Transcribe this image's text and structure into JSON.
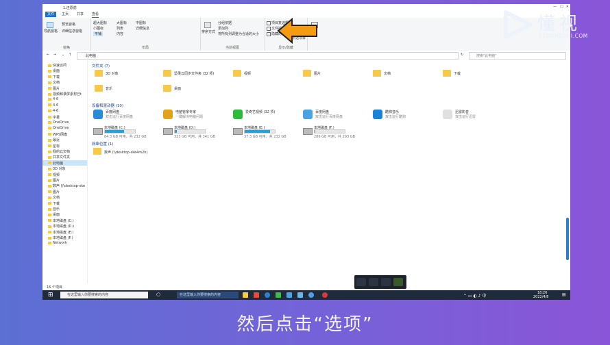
{
  "window": {
    "title": "1.还原前"
  },
  "menubar": {
    "items": [
      "文件",
      "主页",
      "共享",
      "查看"
    ]
  },
  "ribbon": {
    "groups": [
      {
        "name": "窗格",
        "buttons": [
          "导航窗格",
          "预览窗格",
          "详细信息窗格"
        ]
      },
      {
        "name": "布局",
        "buttons": [
          "超大图标",
          "大图标",
          "中图标",
          "小图标",
          "列表",
          "详细信息",
          "平铺",
          "内容"
        ]
      },
      {
        "name": "当前视图",
        "buttons": [
          "排序方式",
          "分组依据",
          "添加列",
          "将所有列调整为合适的大小"
        ]
      },
      {
        "name": "显示/隐藏",
        "buttons": [
          "项目复选框",
          "文件扩展名",
          "隐藏的项目",
          "隐藏",
          "所选项目"
        ]
      },
      {
        "name": "",
        "buttons": [
          "选项"
        ]
      }
    ]
  },
  "addressbar": {
    "path": "此电脑",
    "search_placeholder": "搜索\"此电脑\""
  },
  "nav": {
    "items": [
      "快速访问",
      "桌面",
      "下载",
      "文档",
      "图片",
      "视频和录屏素材已t",
      "4-6",
      "4-6",
      "4-6",
      "字幕",
      "OneDrive",
      "OneDrive",
      "WPS网盘",
      "最近",
      "星标",
      "我的云文档",
      "共享文件夹",
      "此电脑",
      "3D 对象",
      "视频",
      "图片",
      "数声 (\\\\desktop-ske",
      "图片",
      "文档",
      "下载",
      "音乐",
      "桌面",
      "本地磁盘 (C:)",
      "本地磁盘 (D:)",
      "本地磁盘 (E:)",
      "本地磁盘 (F:)",
      "Network"
    ],
    "selected": "此电脑"
  },
  "content": {
    "folders_header": "文件夹 (7)",
    "folders": [
      "3D 对象",
      "坚果云同步文件夹 (32 项)",
      "视频",
      "图片",
      "文档",
      "下载",
      "音乐",
      "桌面"
    ],
    "devices_header": "设备和驱动器 (10)",
    "apps": [
      {
        "name": "百度网盘",
        "sub": "双击运行百度网盘"
      },
      {
        "name": "电脑管家专家",
        "sub": "一键解决电脑问题"
      },
      {
        "name": "爱奇艺视频 (32 项)",
        "sub": ""
      },
      {
        "name": "百度网盘",
        "sub": "双击运行百度网盘"
      },
      {
        "name": "酷狗音乐",
        "sub": "双击运行酷狗"
      },
      {
        "name": "迅雷影音",
        "sub": "双击运行迅雷"
      }
    ],
    "drives": [
      {
        "name": "本地磁盘 (C:)",
        "free": "84.3 GB 可用，共 232 GB",
        "used": 0.64
      },
      {
        "name": "本地磁盘 (D:)",
        "free": "323 GB 可用，共 341 GB",
        "used": 0.06
      },
      {
        "name": "本地磁盘 (E:)",
        "free": "37.3 GB 可用，共 232 GB",
        "used": 0.84
      },
      {
        "name": "本地磁盘 (F:)",
        "free": "286 GB 可用，共 293 GB",
        "used": 0.03
      }
    ],
    "network_header": "网络位置 (1)",
    "network": [
      "数声 (\\\\desktop-ske4m2h)"
    ]
  },
  "status": {
    "count": "16 个项目"
  },
  "taskbar": {
    "search_placeholder": "在这里输入你要搜索的内容",
    "search_placeholder2": "在这里输入你要搜索的内容",
    "time": "18:26",
    "date": "2022/4/8"
  },
  "logo": {
    "brand": "懂视",
    "sub": "51DONGSHI.COM"
  },
  "caption": "然后点击“选项”",
  "colors": {
    "accent": "#1a73c8",
    "arrow": "#f39c12",
    "bg_left": "#5c6fd3",
    "bg_right": "#8a55d8"
  }
}
